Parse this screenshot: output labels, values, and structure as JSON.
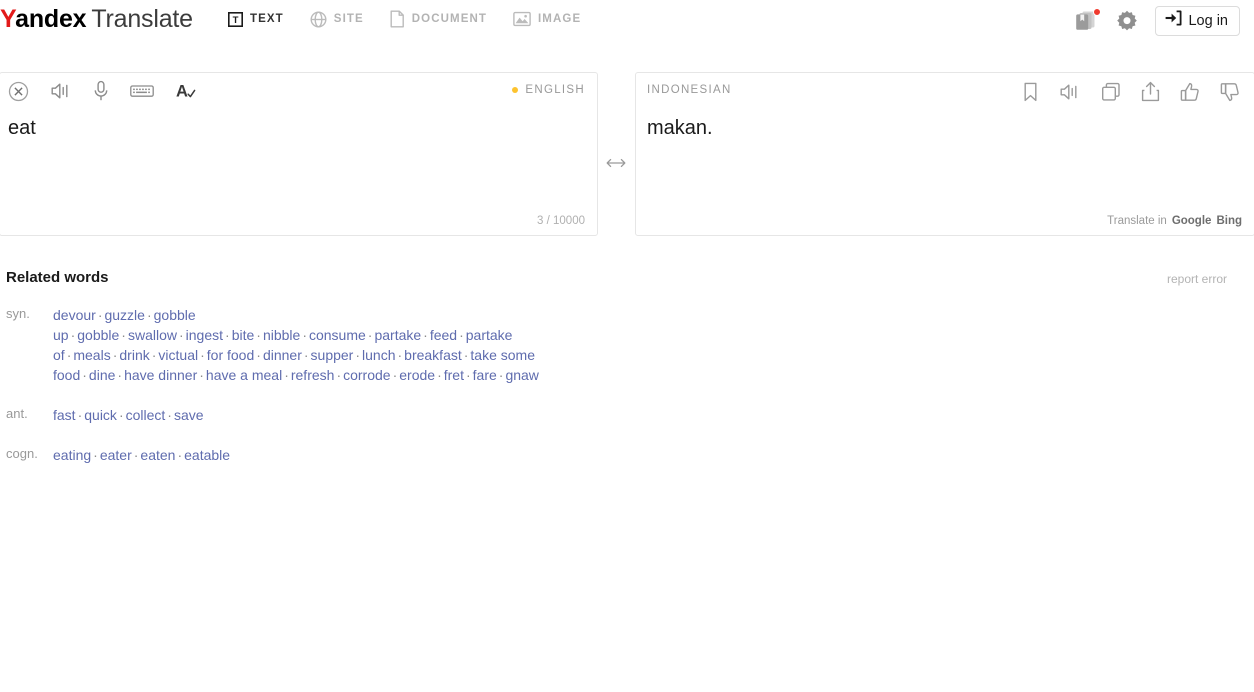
{
  "header": {
    "logo": {
      "brand_first": "Y",
      "brand_rest": "andex",
      "product": "Translate"
    },
    "tabs": [
      {
        "label": "TEXT",
        "icon": "text-icon",
        "active": true
      },
      {
        "label": "SITE",
        "icon": "globe-icon",
        "active": false
      },
      {
        "label": "DOCUMENT",
        "icon": "document-icon",
        "active": false
      },
      {
        "label": "IMAGE",
        "icon": "image-icon",
        "active": false
      }
    ],
    "collections_icon": "collections-icon",
    "settings_icon": "gear-icon",
    "login_label": "Log in"
  },
  "source": {
    "language": "ENGLISH",
    "text": "eat",
    "counter": "3 / 10000",
    "tools": [
      "clear-icon",
      "listen-icon",
      "microphone-icon",
      "keyboard-icon",
      "spellcheck-icon"
    ]
  },
  "swap_icon": "swap-arrows-icon",
  "target": {
    "language": "INDONESIAN",
    "text": "makan.",
    "translate_in_label": "Translate in",
    "engines": [
      "Google",
      "Bing"
    ],
    "tools": [
      "bookmark-icon",
      "listen-icon",
      "copy-icon",
      "share-icon",
      "thumbs-up-icon",
      "thumbs-down-icon"
    ]
  },
  "related": {
    "title": "Related words",
    "report_error": "report error",
    "groups": [
      {
        "label": "syn.",
        "words": [
          "devour",
          "guzzle",
          "gobble up",
          "gobble",
          "swallow",
          "ingest",
          "bite",
          "nibble",
          "consume",
          "partake",
          "feed",
          "partake of",
          "meals",
          "drink",
          "victual",
          "for food",
          "dinner",
          "supper",
          "lunch",
          "breakfast",
          "take some food",
          "dine",
          "have dinner",
          "have a meal",
          "refresh",
          "corrode",
          "erode",
          "fret",
          "fare",
          "gnaw"
        ]
      },
      {
        "label": "ant.",
        "words": [
          "fast",
          "quick",
          "collect",
          "save"
        ]
      },
      {
        "label": "cogn.",
        "words": [
          "eating",
          "eater",
          "eaten",
          "eatable"
        ]
      }
    ]
  },
  "colors": {
    "brand_red": "#e21a1a",
    "link_blue": "#5f6cae",
    "muted_gray": "#999999",
    "lang_dot_yellow": "#fdc32f",
    "notification_red": "#f03a2e"
  }
}
